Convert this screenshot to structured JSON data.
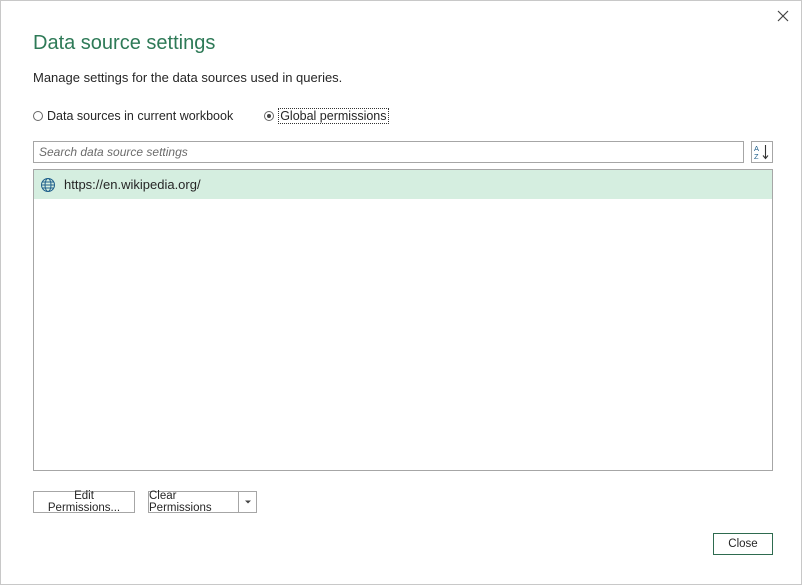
{
  "dialog": {
    "title": "Data source settings",
    "subtitle": "Manage settings for the data sources used in queries."
  },
  "scope": {
    "options": [
      {
        "label": "Data sources in current workbook",
        "selected": false
      },
      {
        "label": "Global permissions",
        "selected": true
      }
    ]
  },
  "search": {
    "placeholder": "Search data source settings",
    "value": ""
  },
  "sort": {
    "icon": "sort-az-icon"
  },
  "sources": [
    {
      "url": "https://en.wikipedia.org/",
      "icon": "globe-icon",
      "selected": true
    }
  ],
  "buttons": {
    "edit_permissions": "Edit Permissions...",
    "clear_permissions": "Clear Permissions",
    "close": "Close"
  },
  "colors": {
    "accent": "#2e7a57",
    "selection": "#d5eee0"
  }
}
